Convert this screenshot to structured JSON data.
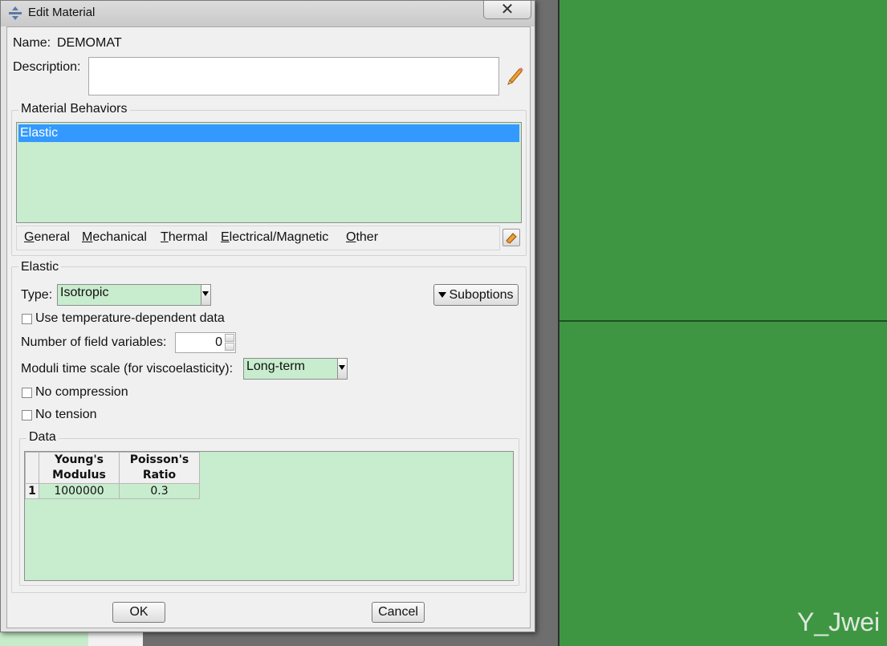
{
  "window": {
    "title": "Edit Material",
    "close": "✕"
  },
  "material": {
    "name_label": "Name:",
    "name_value": "DEMOMAT",
    "description_label": "Description:",
    "description_value": ""
  },
  "behaviors": {
    "group_label": "Material Behaviors",
    "items": [
      "Elastic"
    ],
    "selected": "Elastic"
  },
  "menu": [
    {
      "mnemonic": "G",
      "rest": "eneral"
    },
    {
      "mnemonic": "M",
      "rest": "echanical"
    },
    {
      "mnemonic": "T",
      "rest": "hermal"
    },
    {
      "mnemonic": "E",
      "rest": "lectrical/Magnetic"
    },
    {
      "mnemonic": "O",
      "rest": "ther"
    }
  ],
  "elastic": {
    "group_label": "Elastic",
    "type_label": "Type:",
    "type_value": "Isotropic",
    "suboptions_label": "Suboptions",
    "temp_dependent_label": "Use temperature-dependent data",
    "temp_dependent_checked": false,
    "field_vars_label": "Number of field variables:",
    "field_vars_value": "0",
    "moduli_label": "Moduli time scale (for viscoelasticity):",
    "moduli_value": "Long-term",
    "no_compression_label": "No compression",
    "no_compression_checked": false,
    "no_tension_label": "No tension",
    "no_tension_checked": false
  },
  "data": {
    "group_label": "Data",
    "columns": [
      {
        "line1": "Young's",
        "line2": "Modulus"
      },
      {
        "line1": "Poisson's",
        "line2": "Ratio"
      }
    ],
    "rows": [
      {
        "index": "1",
        "values": [
          "1000000",
          "0.3"
        ]
      }
    ]
  },
  "buttons": {
    "ok": "OK",
    "cancel": "Cancel"
  },
  "watermark": "Y_Jwei",
  "colors": {
    "viewport": "#3f9642",
    "selection": "#3399ff",
    "editable_bg": "#c8ecce"
  }
}
